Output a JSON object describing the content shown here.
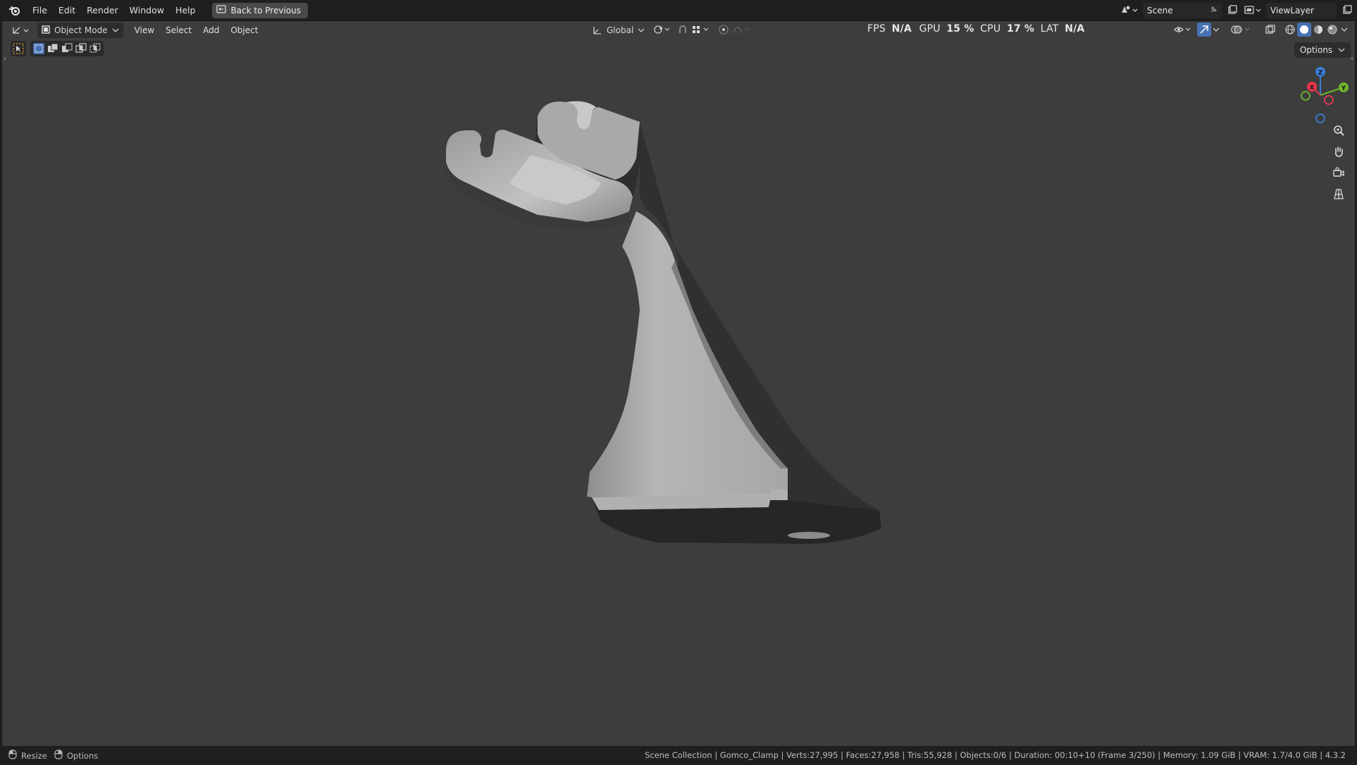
{
  "menubar": {
    "items": [
      "File",
      "Edit",
      "Render",
      "Window",
      "Help"
    ],
    "back_button": "Back to Previous",
    "scene_label": "Scene",
    "viewlayer_label": "ViewLayer"
  },
  "viewport_header": {
    "mode": "Object Mode",
    "menus": [
      "View",
      "Select",
      "Add",
      "Object"
    ],
    "orientation": "Global",
    "options": "Options"
  },
  "stats": {
    "fps_label": "FPS",
    "fps_value": "N/A",
    "gpu_label": "GPU",
    "gpu_value": "15 %",
    "cpu_label": "CPU",
    "cpu_value": "17 %",
    "lat_label": "LAT",
    "lat_value": "N/A"
  },
  "gizmo": {
    "x": "X",
    "y": "Y",
    "z": "Z"
  },
  "statusbar": {
    "left_1": "Resize",
    "left_2": "Options",
    "right": "Scene Collection | Gomco_Clamp | Verts:27,995 | Faces:27,958 | Tris:55,928 | Objects:0/6 | Duration: 00:10+10 (Frame 3/250) | Memory: 1.09 GiB | VRAM: 1.7/4.0 GiB | 4.3.2"
  },
  "colors": {
    "viewport_bg": "#3d3d3d",
    "axis_x": "#e8364f",
    "axis_y": "#6fb62a",
    "axis_z": "#3a7fd6",
    "active_blue": "#4772b3"
  }
}
